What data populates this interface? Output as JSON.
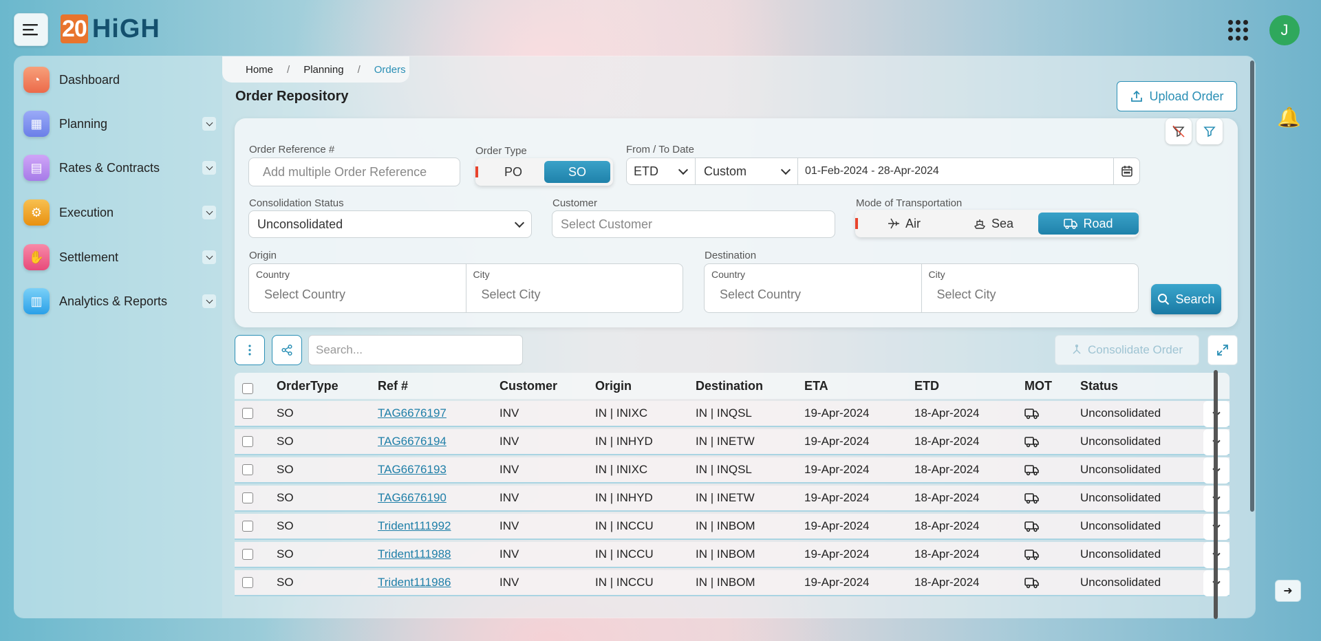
{
  "app": {
    "logo_num": "20",
    "logo_word": "HiGH",
    "avatar_initial": "J"
  },
  "sidebar": {
    "items": [
      {
        "label": "Dashboard",
        "icon": "dashboard-icon",
        "color": "#f07a5a"
      },
      {
        "label": "Planning",
        "icon": "planning-icon",
        "color": "#7b8ff0"
      },
      {
        "label": "Rates & Contracts",
        "icon": "document-icon",
        "color": "#b98bf0"
      },
      {
        "label": "Execution",
        "icon": "gear-icon",
        "color": "#f0a020"
      },
      {
        "label": "Settlement",
        "icon": "handshake-icon",
        "color": "#f05a8a"
      },
      {
        "label": "Analytics & Reports",
        "icon": "analytics-icon",
        "color": "#3ab0f0"
      }
    ]
  },
  "breadcrumb": {
    "home": "Home",
    "planning": "Planning",
    "orders": "Orders",
    "sep": "/"
  },
  "page": {
    "title": "Order Repository",
    "upload_label": "Upload Order"
  },
  "filters": {
    "order_ref_label": "Order Reference #",
    "order_ref_placeholder": "Add multiple Order Reference",
    "order_type_label": "Order Type",
    "order_type_options": [
      "PO",
      "SO"
    ],
    "order_type_selected": "SO",
    "date_label": "From / To Date",
    "date_field": "ETD",
    "date_mode": "Custom",
    "date_range": "01-Feb-2024 - 28-Apr-2024",
    "consolidation_label": "Consolidation Status",
    "consolidation_value": "Unconsolidated",
    "customer_label": "Customer",
    "customer_placeholder": "Select Customer",
    "mot_label": "Mode of Transportation",
    "mot_options": [
      "Air",
      "Sea",
      "Road"
    ],
    "mot_selected": "Road",
    "origin_label": "Origin",
    "destination_label": "Destination",
    "country_label": "Country",
    "city_label": "City",
    "country_placeholder": "Select Country",
    "city_placeholder": "Select City",
    "search_label": "Search"
  },
  "grid": {
    "search_placeholder": "Search...",
    "consolidate_label": "Consolidate Order",
    "columns": [
      "OrderType",
      "Ref #",
      "Customer",
      "Origin",
      "Destination",
      "ETA",
      "ETD",
      "MOT",
      "Status"
    ],
    "rows": [
      {
        "type": "SO",
        "ref": "TAG6676197",
        "customer": "INV",
        "origin": "IN | INIXC",
        "dest": "IN | INQSL",
        "eta": "19-Apr-2024",
        "etd": "18-Apr-2024",
        "status": "Unconsolidated"
      },
      {
        "type": "SO",
        "ref": "TAG6676194",
        "customer": "INV",
        "origin": "IN | INHYD",
        "dest": "IN | INETW",
        "eta": "19-Apr-2024",
        "etd": "18-Apr-2024",
        "status": "Unconsolidated"
      },
      {
        "type": "SO",
        "ref": "TAG6676193",
        "customer": "INV",
        "origin": "IN | INIXC",
        "dest": "IN | INQSL",
        "eta": "19-Apr-2024",
        "etd": "18-Apr-2024",
        "status": "Unconsolidated"
      },
      {
        "type": "SO",
        "ref": "TAG6676190",
        "customer": "INV",
        "origin": "IN | INHYD",
        "dest": "IN | INETW",
        "eta": "19-Apr-2024",
        "etd": "18-Apr-2024",
        "status": "Unconsolidated"
      },
      {
        "type": "SO",
        "ref": "Trident111992",
        "customer": "INV",
        "origin": "IN | INCCU",
        "dest": "IN | INBOM",
        "eta": "19-Apr-2024",
        "etd": "18-Apr-2024",
        "status": "Unconsolidated"
      },
      {
        "type": "SO",
        "ref": "Trident111988",
        "customer": "INV",
        "origin": "IN | INCCU",
        "dest": "IN | INBOM",
        "eta": "19-Apr-2024",
        "etd": "18-Apr-2024",
        "status": "Unconsolidated"
      },
      {
        "type": "SO",
        "ref": "Trident111986",
        "customer": "INV",
        "origin": "IN | INCCU",
        "dest": "IN | INBOM",
        "eta": "19-Apr-2024",
        "etd": "18-Apr-2024",
        "status": "Unconsolidated"
      }
    ]
  },
  "colors": {
    "accent": "#2a8fb5",
    "toggle_on": "#1f82aa",
    "required_marker": "#e8442d",
    "avatar": "#2fa85c"
  }
}
